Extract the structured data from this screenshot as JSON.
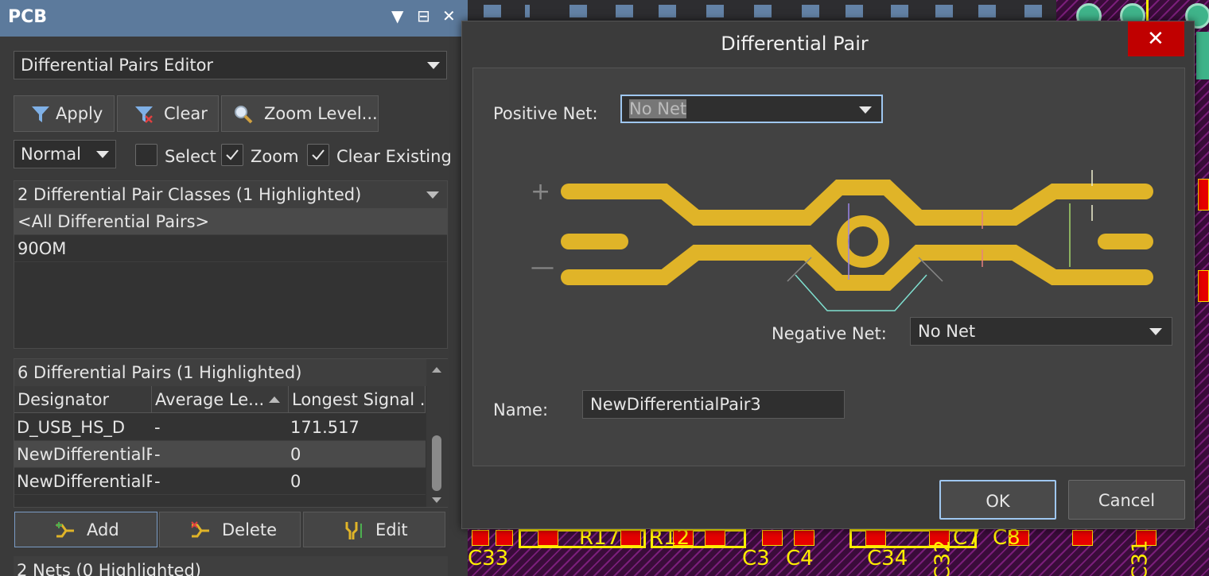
{
  "panel": {
    "title": "PCB",
    "controls": {
      "menu": "▼",
      "pin": "⊟",
      "close": "✕"
    },
    "mode_select": "Differential Pairs Editor",
    "buttons": {
      "apply": "Apply",
      "clear": "Clear",
      "zoom_level": "Zoom Level..."
    },
    "filter_mode": "Normal",
    "checkboxes": {
      "select": {
        "label": "Select",
        "checked": false
      },
      "zoom": {
        "label": "Zoom",
        "checked": true
      },
      "clear_existing": {
        "label": "Clear Existing",
        "checked": true
      }
    },
    "classes": {
      "header": "2 Differential Pair Classes (1 Highlighted)",
      "items": [
        "<All Differential Pairs>",
        "90OM"
      ]
    },
    "pairs": {
      "header": "6 Differential Pairs (1 Highlighted)",
      "columns": [
        "Designator",
        "Average Le...",
        "Longest Signal ..."
      ],
      "rows": [
        [
          "D_USB_HS_D",
          "-",
          "171.517"
        ],
        [
          "NewDifferentialPair",
          "-",
          "0"
        ],
        [
          "NewDifferentialPair",
          "-",
          "0"
        ]
      ]
    },
    "actions": {
      "add": "Add",
      "delete": "Delete",
      "edit": "Edit"
    },
    "nets_header": "2 Nets (0 Highlighted)"
  },
  "pcb": {
    "silk_labels": [
      "C33",
      "R17",
      "R12",
      "C3",
      "C4",
      "C34",
      "C32",
      "C7",
      "C8",
      "C31"
    ]
  },
  "dialog": {
    "title": "Differential Pair",
    "close": "✕",
    "positive_net": {
      "label": "Positive Net:",
      "value": "No Net"
    },
    "negative_net": {
      "label": "Negative Net:",
      "value": "No Net"
    },
    "name": {
      "label": "Name:",
      "value": "NewDifferentialPair3"
    },
    "diagram": {
      "plus": "+",
      "minus": "—"
    },
    "ok": "OK",
    "cancel": "Cancel"
  },
  "colors": {
    "panel_title_bg": "#5c7a9c",
    "trace": "#e0b428",
    "close_btn": "#c00000",
    "focus_border": "#9fc7f0"
  }
}
